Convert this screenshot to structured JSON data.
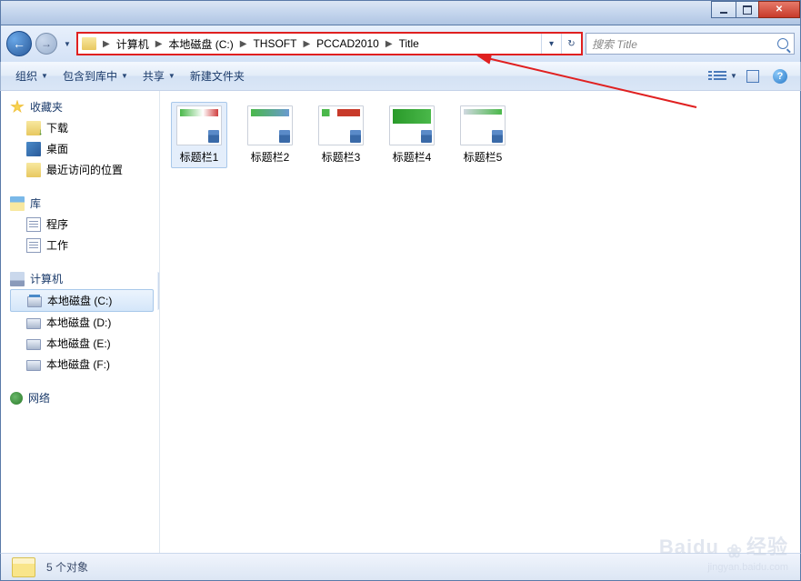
{
  "breadcrumb": {
    "segments": [
      "计算机",
      "本地磁盘 (C:)",
      "THSOFT",
      "PCCAD2010",
      "Title"
    ]
  },
  "search": {
    "placeholder": "搜索 Title"
  },
  "toolbar": {
    "organize": "组织",
    "include": "包含到库中",
    "share": "共享",
    "newfolder": "新建文件夹"
  },
  "sidebar": {
    "favorites": {
      "label": "收藏夹",
      "items": [
        "下载",
        "桌面",
        "最近访问的位置"
      ]
    },
    "libraries": {
      "label": "库",
      "items": [
        "程序",
        "工作"
      ]
    },
    "computer": {
      "label": "计算机",
      "items": [
        "本地磁盘 (C:)",
        "本地磁盘 (D:)",
        "本地磁盘 (E:)",
        "本地磁盘 (F:)"
      ]
    },
    "network": {
      "label": "网络"
    }
  },
  "files": [
    {
      "name": "标题栏1"
    },
    {
      "name": "标题栏2"
    },
    {
      "name": "标题栏3"
    },
    {
      "name": "标题栏4"
    },
    {
      "name": "标题栏5"
    }
  ],
  "status": {
    "count": "5 个对象"
  },
  "watermark": {
    "brand": "Baidu",
    "sub": "经验",
    "url": "jingyan.baidu.com"
  }
}
